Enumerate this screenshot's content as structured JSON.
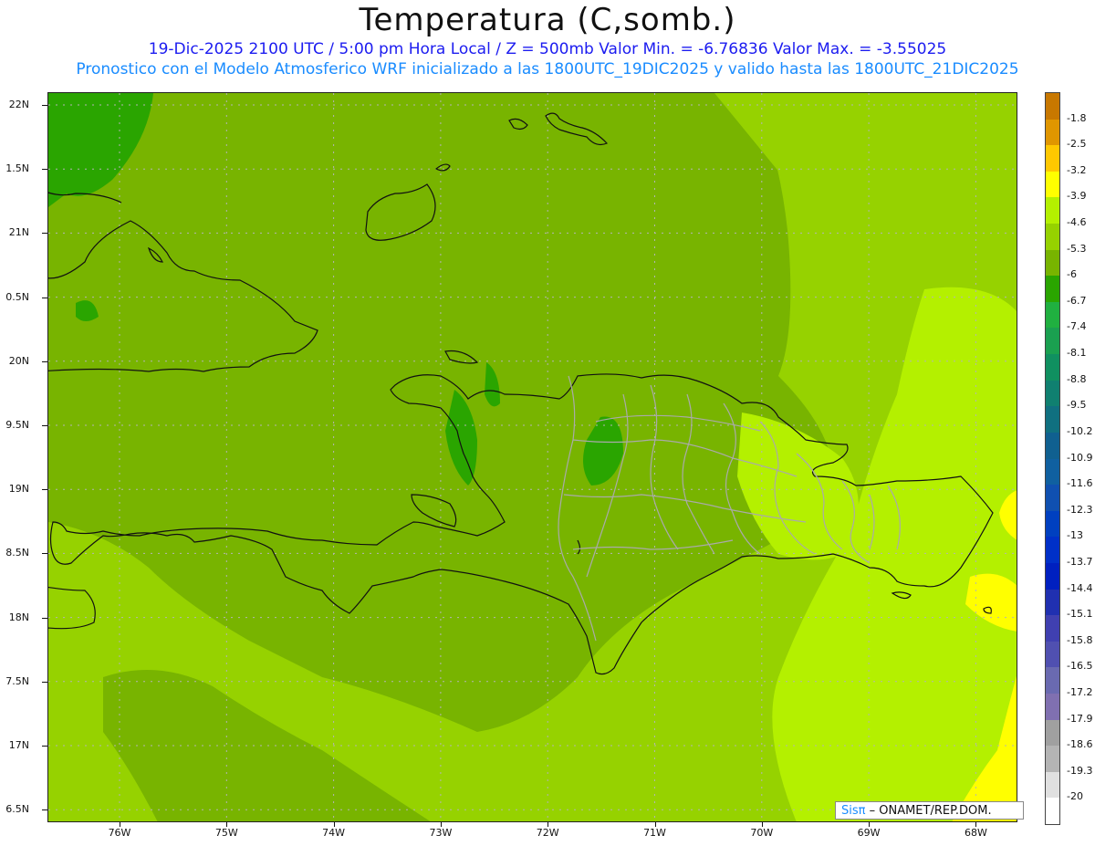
{
  "title": "Temperatura (C,somb.)",
  "subtitle_line1": "19-Dic-2025   2100 UTC / 5:00 pm Hora Local / Z = 500mb  Valor Min. = -6.76836  Valor Max. = -3.55025",
  "subtitle_line2": "Pronostico con el Modelo Atmosferico WRF inicializado a las 1800UTC_19DIC2025 y valido hasta las  1800UTC_21DIC2025",
  "credit": {
    "brand": "Sisπ",
    "rest": " – ONAMET/REP.DOM."
  },
  "axes": {
    "lat_labels": [
      "22N",
      "1.5N",
      "21N",
      "0.5N",
      "20N",
      "9.5N",
      "19N",
      "8.5N",
      "18N",
      "7.5N",
      "17N",
      "6.5N"
    ],
    "lon_labels": [
      "76W",
      "75W",
      "74W",
      "73W",
      "72W",
      "71W",
      "70W",
      "69W",
      "68W"
    ]
  },
  "colorbar": {
    "labels": [
      "-1.8",
      "-2.5",
      "-3.2",
      "-3.9",
      "-4.6",
      "-5.3",
      "-6",
      "-6.7",
      "-7.4",
      "-8.1",
      "-8.8",
      "-9.5",
      "-10.2",
      "-10.9",
      "-11.6",
      "-12.3",
      "-13",
      "-13.7",
      "-14.4",
      "-15.1",
      "-15.8",
      "-16.5",
      "-17.2",
      "-17.9",
      "-18.6",
      "-19.3",
      "-20"
    ],
    "colors": [
      "#c87800",
      "#e09600",
      "#ffc800",
      "#ffff00",
      "#b4f000",
      "#96d200",
      "#78b400",
      "#2aa500",
      "#20b040",
      "#1aa050",
      "#109060",
      "#108070",
      "#107080",
      "#106090",
      "#1060a0",
      "#1050b0",
      "#0040c0",
      "#0030c8",
      "#0020c0",
      "#2030b0",
      "#4040b0",
      "#5050b0",
      "#6a6ab0",
      "#8070b0",
      "#a0a0a0",
      "#b4b4b4",
      "#e0e0e0",
      "#ffffff"
    ]
  },
  "fill_colors": {
    "dark_green": "#2aa500",
    "mid_green": "#78b400",
    "green": "#96d200",
    "light_green": "#b4f000",
    "yellow": "#ffff00",
    "land_outline": "#111111",
    "province_outline": "#aaaaaa"
  }
}
